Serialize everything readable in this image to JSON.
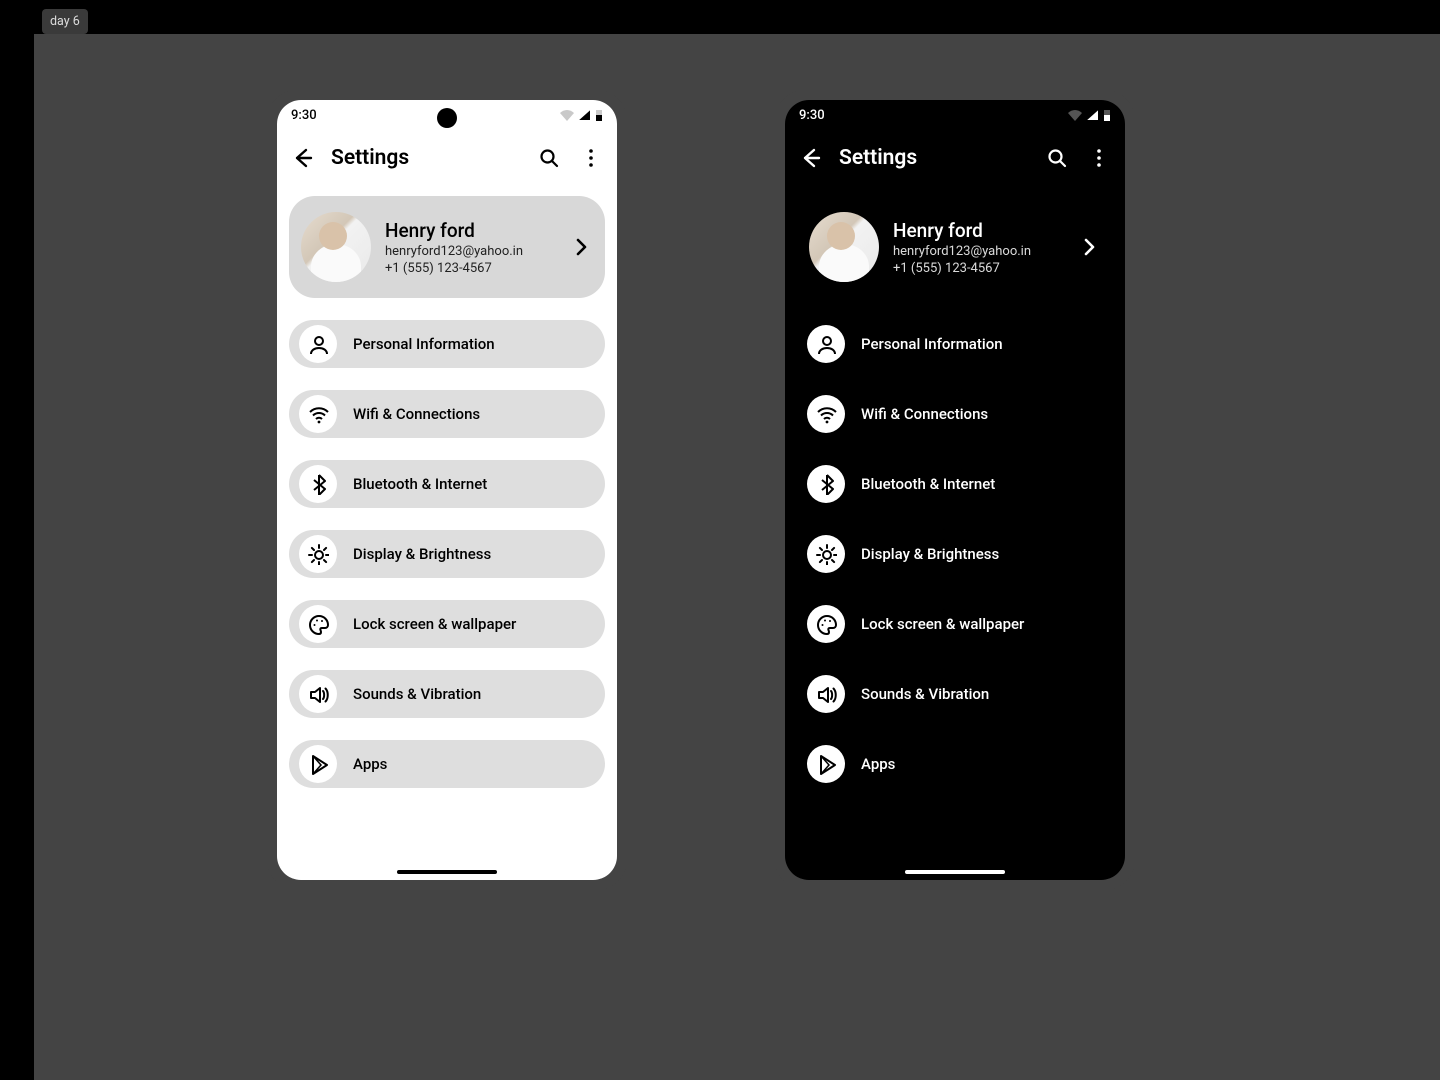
{
  "badge": "day 6",
  "status": {
    "time": "9:30"
  },
  "appbar": {
    "title": "Settings"
  },
  "profile": {
    "name": "Henry ford",
    "email": "henryford123@yahoo.in",
    "phone": "+1 (555) 123-4567"
  },
  "items": [
    {
      "icon": "user",
      "label": "Personal Information"
    },
    {
      "icon": "wifi",
      "label": "Wifi & Connections"
    },
    {
      "icon": "bluetooth",
      "label": "Bluetooth & Internet"
    },
    {
      "icon": "sun",
      "label": "Display & Brightness"
    },
    {
      "icon": "palette",
      "label": "Lock screen & wallpaper"
    },
    {
      "icon": "volume",
      "label": "Sounds & Vibration"
    },
    {
      "icon": "play",
      "label": "Apps"
    }
  ]
}
